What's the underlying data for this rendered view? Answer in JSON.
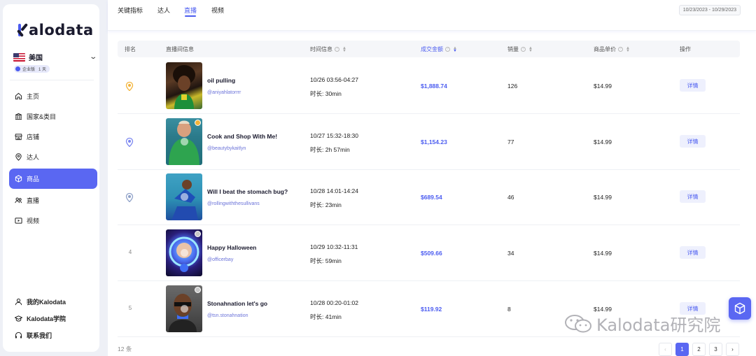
{
  "brand": {
    "name": "alodata"
  },
  "country": {
    "name": "美国",
    "plan": "企业版",
    "days": "1 天"
  },
  "nav": [
    {
      "label": "主页",
      "icon": "home-icon"
    },
    {
      "label": "国家&类目",
      "icon": "bank-icon"
    },
    {
      "label": "店铺",
      "icon": "store-icon"
    },
    {
      "label": "达人",
      "icon": "location-person-icon"
    },
    {
      "label": "商品",
      "icon": "box-icon",
      "active": true
    },
    {
      "label": "直播",
      "icon": "group-icon"
    },
    {
      "label": "视频",
      "icon": "video-icon"
    }
  ],
  "nav_bottom": [
    {
      "label": "我的Kalodata",
      "icon": "user-icon"
    },
    {
      "label": "Kalodata学院",
      "icon": "graduation-cap-icon"
    },
    {
      "label": "联系我们",
      "icon": "headset-icon"
    }
  ],
  "tabs": [
    "关键指标",
    "达人",
    "直播",
    "视频"
  ],
  "active_tab": 2,
  "date_range": "10/23/2023 - 10/29/2023",
  "table": {
    "columns": [
      "排名",
      "直播间信息",
      "时间信息",
      "成交金额",
      "销量",
      "商品单价",
      "操作"
    ],
    "detail_label": "详情",
    "rows": [
      {
        "rank": "1",
        "title": "oil pulling",
        "handle": "@aniyahlatorrrr",
        "time": "10/26 03:56-04:27",
        "duration": "时长: 30min",
        "amount": "$1,888.74",
        "sales": "126",
        "price": "$14.99"
      },
      {
        "rank": "2",
        "title": "Cook and Shop With Me!",
        "handle": "@beautybykaitlyn",
        "time": "10/27 15:32-18:30",
        "duration": "时长: 2h 57min",
        "amount": "$1,154.23",
        "sales": "77",
        "price": "$14.99"
      },
      {
        "rank": "3",
        "title": "Will I beat the stomach bug?",
        "handle": "@rollingwiththesullivans",
        "time": "10/28 14:01-14:24",
        "duration": "时长: 23min",
        "amount": "$689.54",
        "sales": "46",
        "price": "$14.99"
      },
      {
        "rank": "4",
        "title": "Happy Halloween",
        "handle": "@officerbay",
        "time": "10/29 10:32-11:31",
        "duration": "时长: 59min",
        "amount": "$509.66",
        "sales": "34",
        "price": "$14.99"
      },
      {
        "rank": "5",
        "title": "Stonahnation let's go",
        "handle": "@tsn.stonahnation",
        "time": "10/28 00:20-01:02",
        "duration": "时长: 41min",
        "amount": "$119.92",
        "sales": "8",
        "price": "$14.99"
      }
    ]
  },
  "footer": {
    "count": "12 条",
    "pages": [
      "1",
      "2",
      "3"
    ],
    "current_page": "1"
  },
  "watermark": "Kalodata研究院",
  "colors": {
    "accent": "#5a67f2",
    "link": "#4b5cf0",
    "gold": "#f3b43a"
  }
}
